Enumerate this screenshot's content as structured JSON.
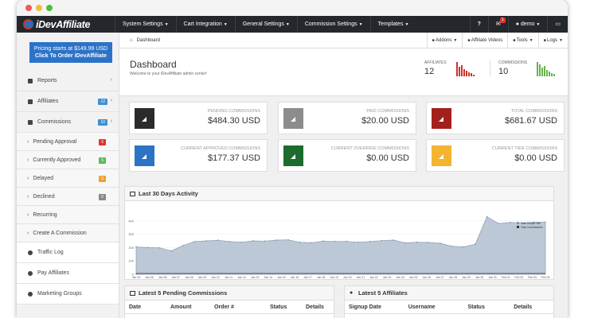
{
  "app": {
    "logo_text": "iDevAffiliate"
  },
  "nav": {
    "menu": [
      {
        "label": "System Settings"
      },
      {
        "label": "Cart Integration"
      },
      {
        "label": "General Settings"
      },
      {
        "label": "Commission Settings"
      },
      {
        "label": "Templates"
      }
    ],
    "notification_count": "1",
    "user": "demo"
  },
  "sidebar": {
    "promo_line1": "Pricing starts at $149.99 USD",
    "promo_line2": "Click To Order iDevAffiliate",
    "items": [
      {
        "label": "Reports"
      },
      {
        "label": "Affiliates",
        "count": "12"
      },
      {
        "label": "Commissions",
        "count": "10"
      }
    ],
    "subitems": [
      {
        "label": "Pending Approval",
        "count": "5",
        "color": "#e2342d"
      },
      {
        "label": "Currently Approved",
        "count": "5",
        "color": "#5fb85c"
      },
      {
        "label": "Delayed",
        "count": "0",
        "color": "#f0a031"
      },
      {
        "label": "Declined",
        "count": "0",
        "color": "#888888"
      },
      {
        "label": "Recurring"
      },
      {
        "label": "Create A Commission"
      }
    ],
    "bottom_items": [
      {
        "label": "Traffic Log"
      },
      {
        "label": "Pay Affiliates"
      },
      {
        "label": "Marketing Groups"
      }
    ]
  },
  "breadcrumb": {
    "label": "Dashboard",
    "tools": [
      {
        "label": "Addons"
      },
      {
        "label": "Affiliate Videos"
      },
      {
        "label": "Tools"
      },
      {
        "label": "Logs"
      }
    ]
  },
  "header": {
    "title": "Dashboard",
    "subtitle": "Welcome to your iDevAffiliate admin center!",
    "affiliates_label": "AFFILIATES",
    "affiliates_value": "12",
    "commissions_label": "COMMISSIONS",
    "commissions_value": "10"
  },
  "cards": [
    {
      "label": "PENDING COMMISSIONS",
      "value": "$484.30 USD",
      "color": "#2b2b2b"
    },
    {
      "label": "PAID COMMISSIONS",
      "value": "$20.00 USD",
      "color": "#8c8c8c"
    },
    {
      "label": "TOTAL COMMISSIONS",
      "value": "$681.67 USD",
      "color": "#a3201c"
    },
    {
      "label": "CURRENT APPROVED COMMISSIONS",
      "value": "$177.37 USD",
      "color": "#2b73c4"
    },
    {
      "label": "CURRENT OVERRIDE COMMISSIONS",
      "value": "$0.00 USD",
      "color": "#1e6b2e"
    },
    {
      "label": "CURRENT TIER COMMISSIONS",
      "value": "$0.00 USD",
      "color": "#f4b331"
    }
  ],
  "activity": {
    "title": "Last 30 Days Activity"
  },
  "chart_data": {
    "type": "area",
    "x": [
      "Jan 04",
      "Jan 05",
      "Jan 06",
      "Jan 07",
      "Jan 08",
      "Jan 09",
      "Jan 10",
      "Jan 11",
      "Jan 12",
      "Jan 13",
      "Jan 14",
      "Jan 15",
      "Jan 16",
      "Jan 17",
      "Jan 18",
      "Jan 19",
      "Jan 20",
      "Jan 21",
      "Jan 22",
      "Jan 23",
      "Jan 24",
      "Jan 25",
      "Jan 26",
      "Jan 27",
      "Jan 28",
      "Jan 29",
      "Jan 30",
      "Jan 31",
      "Feb 01",
      "Feb 02",
      "Feb 03",
      "Feb 04"
    ],
    "ylim": [
      0,
      500
    ],
    "yticks": [
      0,
      100,
      200,
      300,
      400
    ],
    "series": [
      {
        "name": "Total Unique Hits",
        "color": "#8a9bb3",
        "values": [
          205,
          200,
          198,
          175,
          215,
          245,
          250,
          255,
          245,
          240,
          250,
          248,
          256,
          258,
          240,
          236,
          248,
          246,
          246,
          240,
          245,
          252,
          256,
          235,
          240,
          238,
          232,
          210,
          205,
          225,
          430,
          380,
          388,
          385,
          390,
          390
        ]
      },
      {
        "name": "Total Commissions",
        "color": "#333333",
        "values": [
          0,
          0,
          0,
          0,
          0,
          0,
          0,
          0,
          0,
          0,
          0,
          0,
          0,
          0,
          0,
          0,
          0,
          0,
          0,
          0,
          0,
          0,
          0,
          0,
          0,
          0,
          0,
          0,
          0,
          0,
          0,
          0,
          0,
          0,
          0,
          0
        ]
      }
    ],
    "legend": "top-right"
  },
  "pending": {
    "title": "Latest 5 Pending Commissions",
    "columns": [
      "Date",
      "Amount",
      "Order #",
      "Status",
      "Details"
    ]
  },
  "latest_affiliates": {
    "title": "Latest 5 Affiliates",
    "columns": [
      "Signup Date",
      "Username",
      "Status",
      "Details"
    ]
  }
}
